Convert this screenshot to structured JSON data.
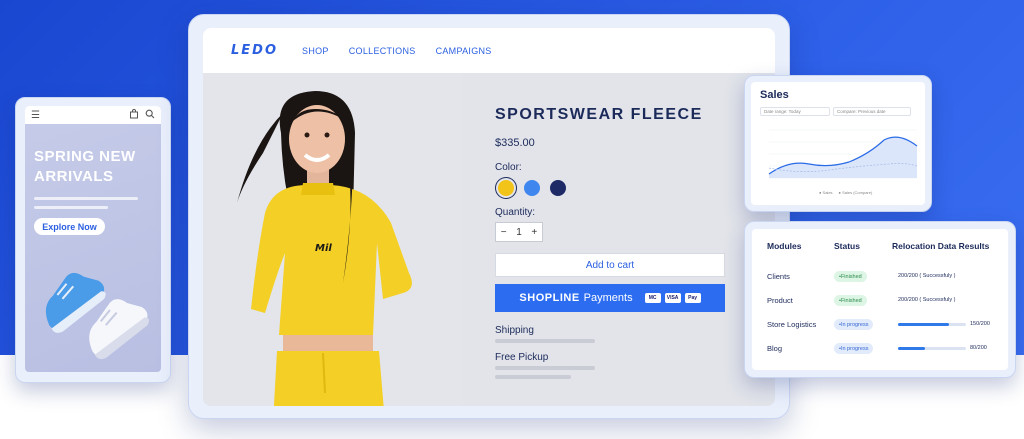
{
  "store": {
    "logo": "LEDO",
    "nav": [
      "SHOP",
      "COLLECTIONS",
      "CAMPAIGNS"
    ]
  },
  "product": {
    "title": "SPORTSWEAR FLEECE",
    "price": "$335.00",
    "color_label": "Color:",
    "colors": [
      "#f2c318",
      "#3f86ee",
      "#1d2a66"
    ],
    "selected_color_index": 0,
    "quantity_label": "Quantity:",
    "quantity": "1",
    "minus": "−",
    "plus": "+",
    "add_to_cart": "Add to cart",
    "payment_brand": "SHOPLINE",
    "payment_text": "Payments",
    "cards": [
      "MC",
      "VISA",
      "Pay"
    ],
    "shipping": "Shipping",
    "pickup": "Free Pickup"
  },
  "mobile": {
    "headline": "SPRING NEW ARRIVALS",
    "cta": "Explore Now"
  },
  "sales": {
    "title": "Sales",
    "date_range": "Date range: Today",
    "compare": "Compare: Previous date",
    "legend": [
      "Sales",
      "Sales (Compare)"
    ]
  },
  "modules": {
    "headers": [
      "Modules",
      "Status",
      "Relocation Data Results"
    ],
    "rows": [
      {
        "name": "Clients",
        "status": "Finished",
        "type": "fin",
        "result": "200/200  ( Successfuly )",
        "progress": 1.0
      },
      {
        "name": "Product",
        "status": "Finished",
        "type": "fin",
        "result": "200/200  ( Successfuly )",
        "progress": 1.0
      },
      {
        "name": "Store Logistics",
        "status": "In progress",
        "type": "prog",
        "result": "150/200",
        "progress": 0.75
      },
      {
        "name": "Blog",
        "status": "In progress",
        "type": "prog",
        "result": "80/200",
        "progress": 0.4
      }
    ]
  },
  "colors": {
    "brand_blue": "#2a5fe0",
    "background_blue": "#1e4fd6",
    "pay_button": "#2c6cf0"
  }
}
